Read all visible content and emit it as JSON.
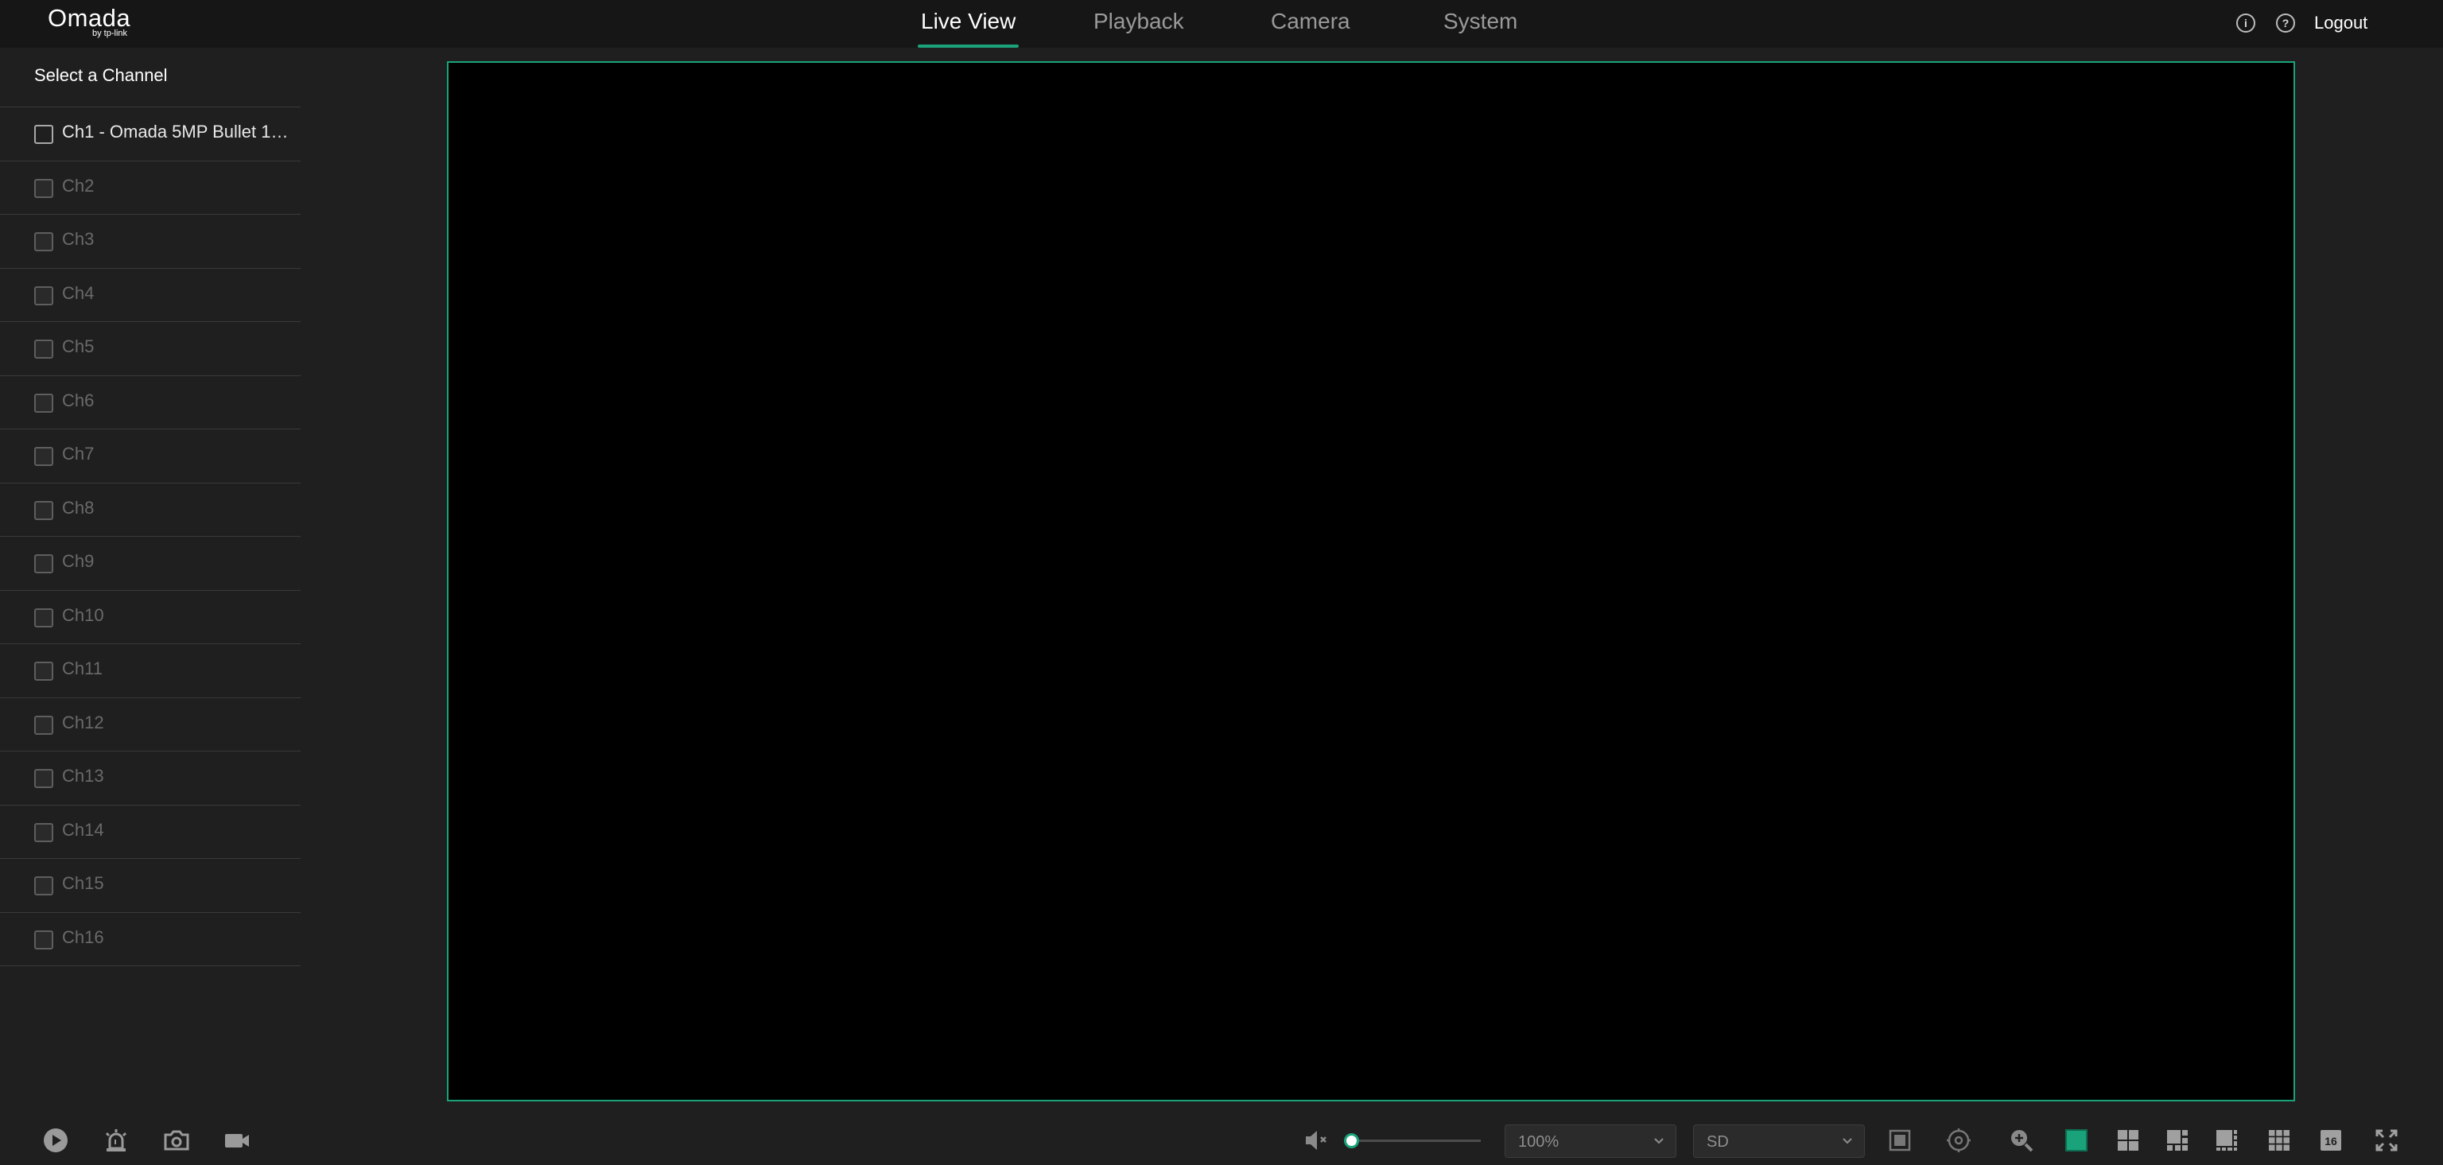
{
  "brand": {
    "logo_text": "Omada",
    "logo_sub": "by tp-link",
    "accent": "#1aa37a"
  },
  "nav": {
    "tabs": [
      {
        "label": "Live View",
        "active": true
      },
      {
        "label": "Playback",
        "active": false
      },
      {
        "label": "Camera",
        "active": false
      },
      {
        "label": "System",
        "active": false
      }
    ]
  },
  "header": {
    "info_icon": "info-icon",
    "help_icon": "help-icon",
    "help_glyph": "?",
    "info_glyph": "i",
    "logout_label": "Logout"
  },
  "sidebar": {
    "title": "Select a Channel",
    "channels": [
      {
        "label": "Ch1 - Omada 5MP Bullet 1.0...",
        "online": true
      },
      {
        "label": "Ch2",
        "online": false
      },
      {
        "label": "Ch3",
        "online": false
      },
      {
        "label": "Ch4",
        "online": false
      },
      {
        "label": "Ch5",
        "online": false
      },
      {
        "label": "Ch6",
        "online": false
      },
      {
        "label": "Ch7",
        "online": false
      },
      {
        "label": "Ch8",
        "online": false
      },
      {
        "label": "Ch9",
        "online": false
      },
      {
        "label": "Ch10",
        "online": false
      },
      {
        "label": "Ch11",
        "online": false
      },
      {
        "label": "Ch12",
        "online": false
      },
      {
        "label": "Ch13",
        "online": false
      },
      {
        "label": "Ch14",
        "online": false
      },
      {
        "label": "Ch15",
        "online": false
      },
      {
        "label": "Ch16",
        "online": false
      }
    ]
  },
  "toolbar": {
    "left_icons": [
      "play-icon",
      "alarm-icon",
      "snapshot-icon",
      "record-icon"
    ],
    "mute_icon": "speaker-muted-icon",
    "volume_level": 0,
    "zoom_value": "100%",
    "stream_value": "SD",
    "right_icons": [
      "fit-screen-icon",
      "ptz-icon",
      "zoom-in-icon",
      "layout-1-icon",
      "layout-4-icon",
      "layout-6-icon",
      "layout-8-icon",
      "layout-9-icon",
      "layout-16-icon",
      "fullscreen-icon"
    ],
    "layout_16_label": "16"
  }
}
